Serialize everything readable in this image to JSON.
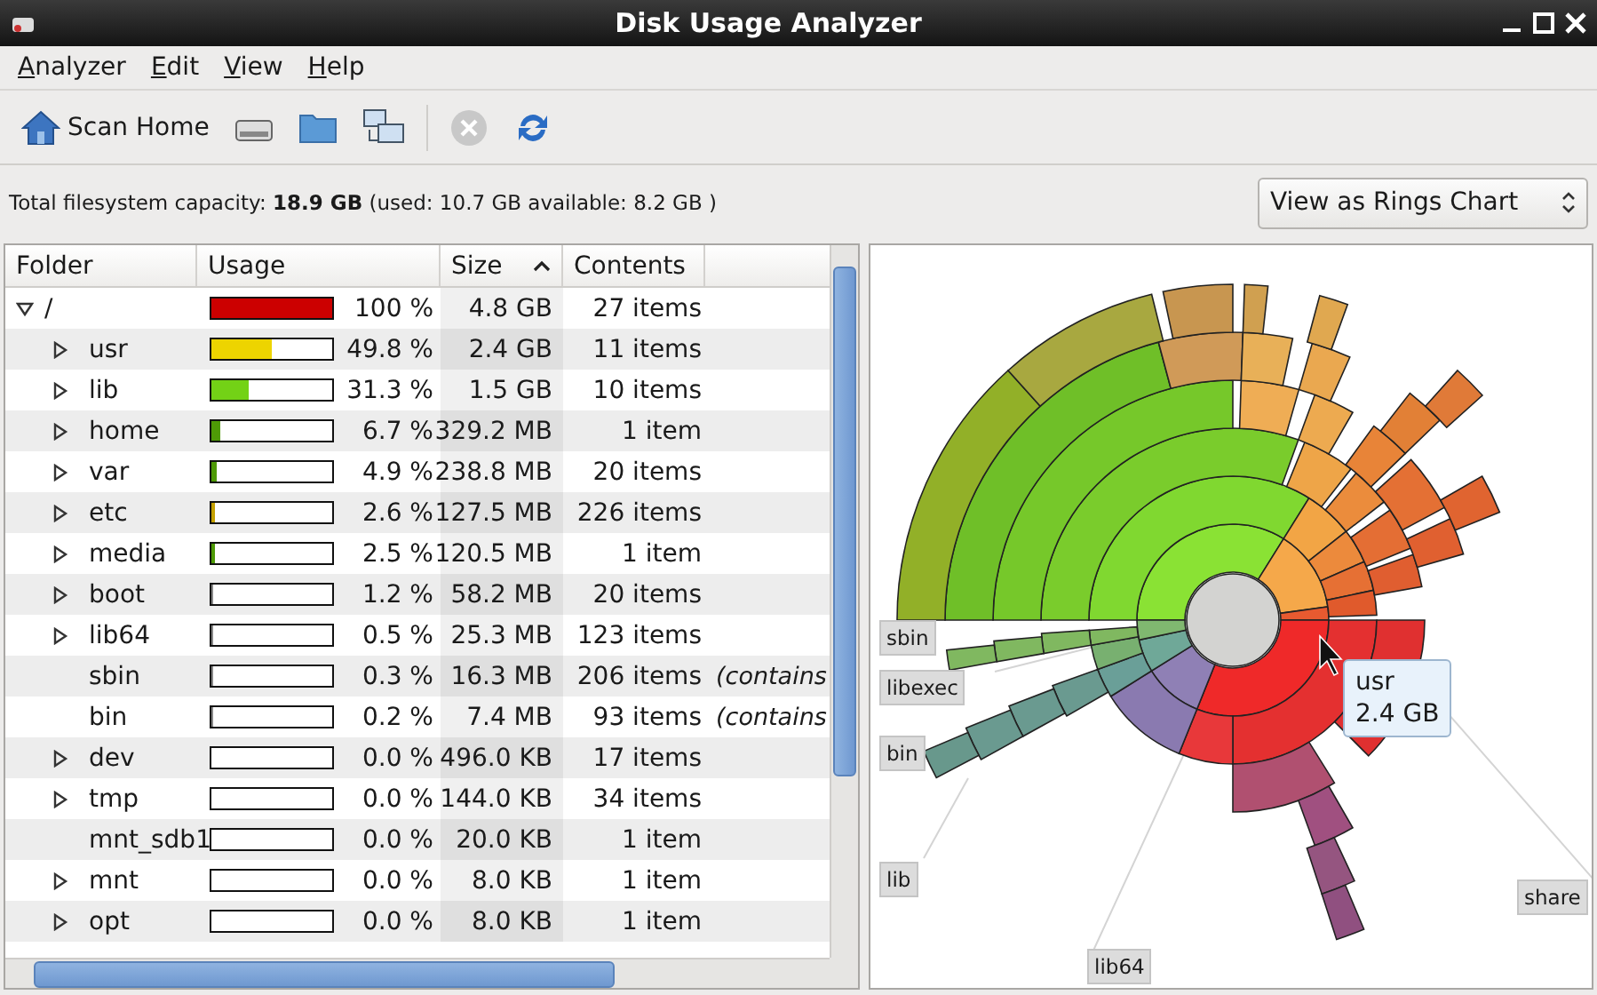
{
  "window": {
    "title": "Disk Usage Analyzer"
  },
  "menu": [
    "Analyzer",
    "Edit",
    "View",
    "Help"
  ],
  "toolbar": {
    "scan_home": "Scan Home",
    "stop_disabled": true
  },
  "capacity": {
    "label": "Total filesystem capacity: ",
    "total": "18.9 GB",
    "detail": " (used: 10.7 GB available: 8.2 GB )"
  },
  "view_select": {
    "value": "View as Rings Chart"
  },
  "table": {
    "columns": [
      {
        "label": "Folder",
        "sorted": false
      },
      {
        "label": "Usage",
        "sorted": false
      },
      {
        "label": "Size",
        "sorted": true
      },
      {
        "label": "Contents",
        "sorted": false
      }
    ],
    "rows": [
      {
        "name": "/",
        "expanded": true,
        "level": 1,
        "color": "#cc0000",
        "percent": "100 %",
        "size": "4.8 GB",
        "contents": "27 items",
        "children": [
          {
            "name": "usr",
            "expanded": false,
            "level": 0.498,
            "color": "#edd400",
            "percent": "49.8 %",
            "size": "2.4 GB",
            "contents": "11 items"
          },
          {
            "name": "lib",
            "expanded": false,
            "level": 0.313,
            "color": "#73d216",
            "percent": "31.3 %",
            "size": "1.5 GB",
            "contents": "10 items"
          },
          {
            "name": "home",
            "expanded": false,
            "level": 0.067,
            "color": "#4e9a06",
            "percent": "6.7 %",
            "size": "329.2 MB",
            "contents": "1 item"
          },
          {
            "name": "var",
            "expanded": false,
            "level": 0.049,
            "color": "#4e9a06",
            "percent": "4.9 %",
            "size": "238.8 MB",
            "contents": "20 items"
          },
          {
            "name": "etc",
            "expanded": false,
            "level": 0.026,
            "color": "#c4a000",
            "percent": "2.6 %",
            "size": "127.5 MB",
            "contents": "226 items"
          },
          {
            "name": "media",
            "expanded": false,
            "level": 0.025,
            "color": "#4e9a06",
            "percent": "2.5 %",
            "size": "120.5 MB",
            "contents": "1 item"
          },
          {
            "name": "boot",
            "expanded": false,
            "level": 0.012,
            "percent": "1.2 %",
            "size": "58.2 MB",
            "contents": "20 items"
          },
          {
            "name": "lib64",
            "expanded": false,
            "level": 0.005,
            "percent": "0.5 %",
            "size": "25.3 MB",
            "contents": "123 items"
          },
          {
            "name": "sbin",
            "level": 0.003,
            "percent": "0.3 %",
            "size": "16.3 MB",
            "contents": "206 items",
            "note": "(contains"
          },
          {
            "name": "bin",
            "level": 0.002,
            "percent": "0.2 %",
            "size": "7.4 MB",
            "contents": "93 items",
            "note": "(contains"
          },
          {
            "name": "dev",
            "expanded": false,
            "level": 0,
            "percent": "0.0 %",
            "size": "496.0 KB",
            "contents": "17 items"
          },
          {
            "name": "tmp",
            "expanded": false,
            "level": 0,
            "percent": "0.0 %",
            "size": "144.0 KB",
            "contents": "34 items"
          },
          {
            "name": "mnt_sdb1",
            "level": 0,
            "percent": "0.0 %",
            "size": "20.0 KB",
            "contents": "1 item"
          },
          {
            "name": "mnt",
            "expanded": false,
            "level": 0,
            "percent": "0.0 %",
            "size": "8.0 KB",
            "contents": "1 item"
          },
          {
            "name": "opt",
            "expanded": false,
            "level": 0,
            "percent": "0.0 %",
            "size": "8.0 KB",
            "contents": "1 item"
          }
        ]
      }
    ]
  },
  "chart": {
    "labels": [
      "sbin",
      "libexec",
      "bin",
      "lib",
      "lib64",
      "share"
    ],
    "tooltip": {
      "name": "usr",
      "size": "2.4 GB"
    }
  }
}
